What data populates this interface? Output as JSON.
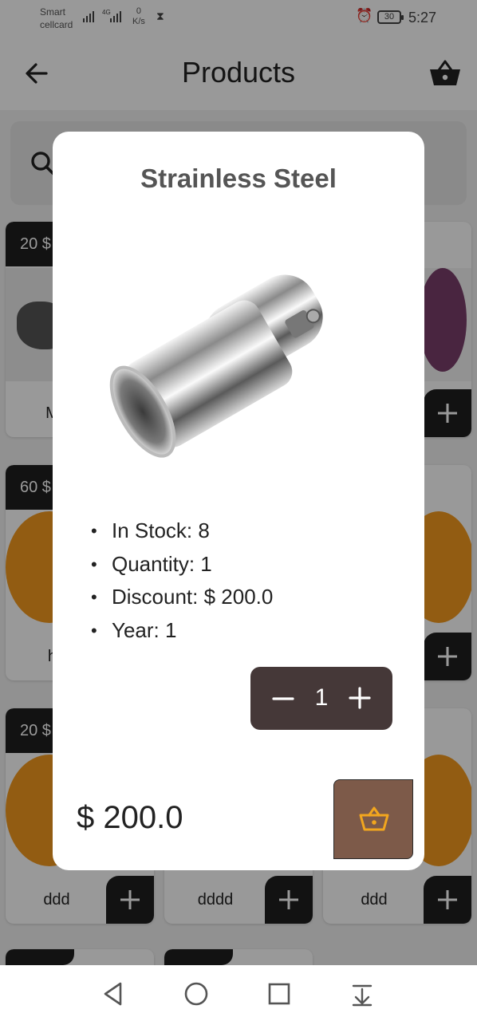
{
  "status_bar": {
    "carrier_line1": "Smart",
    "carrier_line2": "cellcard",
    "net_type": "4G",
    "speed_value": "0",
    "speed_unit": "K/s",
    "battery": "30",
    "time": "5:27"
  },
  "app_bar": {
    "title": "Products",
    "back_icon": "arrow-left-icon",
    "cart_icon": "basket-icon"
  },
  "search": {
    "icon": "search-icon"
  },
  "products": [
    {
      "price": "20 $",
      "name": "Ma"
    },
    {
      "price": "60 $",
      "name": "hd"
    },
    {
      "price": "20 $",
      "name": "ddd"
    },
    {
      "price": "",
      "name": "dddd"
    },
    {
      "price": "",
      "name": "ddd"
    }
  ],
  "dialog": {
    "title": "Strainless Steel",
    "details": [
      "In Stock: 8",
      "Quantity: 1",
      "Discount: $ 200.0",
      "Year: 1"
    ],
    "quantity": "1",
    "total": "$ 200.0",
    "add_to_cart_icon": "basket-icon"
  },
  "colors": {
    "stepper_bg": "#453838",
    "add_to_cart_bg": "#7d5a49",
    "basket_icon": "#f2a61e",
    "card_badge": "#1e1e1e"
  }
}
